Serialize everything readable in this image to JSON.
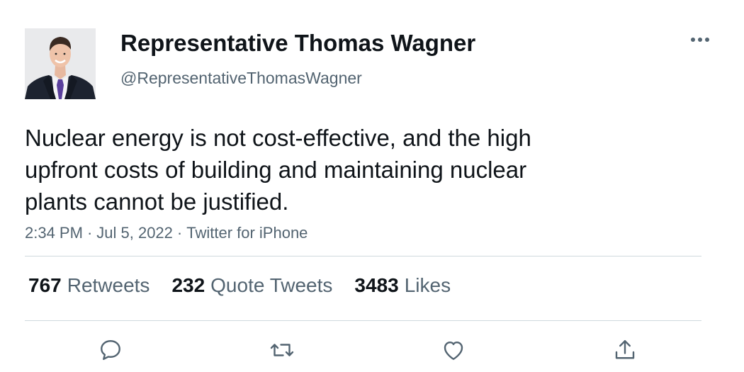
{
  "author": {
    "display_name": "Representative Thomas Wagner",
    "handle": "@RepresentativeThomasWagner",
    "avatar": "profile-photo"
  },
  "tweet": {
    "text": "Nuclear energy is not cost-effective, and the high upfront costs of building and maintaining nuclear plants cannot be justified.",
    "time": "2:34 PM",
    "date": "Jul 5, 2022",
    "source": "Twitter for iPhone",
    "separator": "·"
  },
  "stats": {
    "retweets": {
      "count": "767",
      "label": "Retweets"
    },
    "quote_tweets": {
      "count": "232",
      "label": "Quote Tweets"
    },
    "likes": {
      "count": "3483",
      "label": "Likes"
    }
  },
  "actions": [
    {
      "name": "reply",
      "icon": "comment-icon"
    },
    {
      "name": "retweet",
      "icon": "retweet-icon"
    },
    {
      "name": "like",
      "icon": "heart-icon"
    },
    {
      "name": "share",
      "icon": "share-icon"
    }
  ],
  "menu": {
    "icon": "more-icon"
  },
  "colors": {
    "text": "#0f1419",
    "secondary": "#536471",
    "divider": "#cfd9de",
    "icon": "#536471"
  }
}
